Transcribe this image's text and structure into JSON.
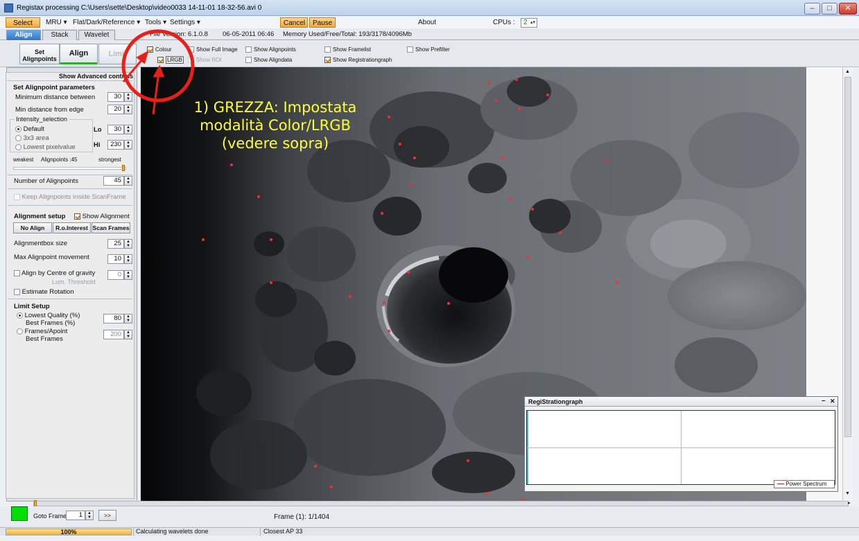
{
  "window": {
    "title": "Registax processing C:\\Users\\sette\\Desktop\\video0033 14-11-01 18-32-56.avi 0"
  },
  "menu": {
    "select": "Select",
    "mru": "MRU",
    "flat": "Flat/Dark/Reference",
    "tools": "Tools",
    "settings": "Settings",
    "cancel": "Cancel",
    "pause": "Pause",
    "about": "About",
    "cpus_label": "CPUs :",
    "cpus_value": "2"
  },
  "tabs": {
    "align": "Align",
    "stack": "Stack",
    "wavelet": "Wavelet"
  },
  "info": {
    "file_version": "File Version: 6.1.0.8",
    "date": "06-05-2011 06:46",
    "memory": "Memory Used/Free/Total: 193/3178/4096Mb"
  },
  "toolbar": {
    "set_alignpoints_1": "Set",
    "set_alignpoints_2": "Alignpoints",
    "align": "Align",
    "limit": "Limit"
  },
  "options": {
    "colour": "Colour",
    "lrgb": "LRGB",
    "show_full_image": "Show Full Image",
    "show_roi": "Show ROI",
    "show_alignpoints": "Show Alignpoints",
    "show_aligndata": "Show Aligndata",
    "show_framelist": "Show Framelist",
    "show_registrationgraph": "Show Registrationgraph",
    "show_prefilter": "Show Prefilter"
  },
  "panel": {
    "show_advanced": "Show Advanced controls",
    "set_ap_title": "Set Alignpoint parameters",
    "min_dist_between": "Minimum distance between",
    "min_dist_between_val": "30",
    "min_dist_edge": "Min distance from edge",
    "min_dist_edge_val": "20",
    "intensity_selection": "Intensity_selection",
    "default": "Default",
    "area3x3": "3x3 area",
    "lowest_pixel": "Lowest pixelvalue",
    "lo_label": "Lo",
    "lo_val": "30",
    "hi_label": "Hi",
    "hi_val": "230",
    "weakest": "weakest",
    "alignpoints_count": "Alignpoints :45",
    "strongest": "strongest",
    "num_alignpoints": "Number of Alignpoints",
    "num_alignpoints_val": "45",
    "keep_inside": "Keep Alignpoints inside ScanFrame",
    "alignment_setup": "Alignment setup",
    "show_alignment": "Show Alignment",
    "no_align": "No Align",
    "ro_interest": "R.o.Interest",
    "scan_frames": "Scan Frames",
    "alignbox_size": "Alignmentbox size",
    "alignbox_size_val": "25",
    "max_ap_move": "Max Alignpoint movement",
    "max_ap_move_val": "10",
    "align_cog": "Align by Centre of gravity",
    "align_cog_val": "0",
    "lum_threshold": "Lum. Threshold",
    "estimate_rotation": "Estimate Rotation",
    "limit_setup": "Limit Setup",
    "lowest_quality": "Lowest Quality (%)",
    "lowest_quality_val": "80",
    "best_frames_pct": "Best Frames (%)",
    "frames_apoint": "Frames/Apoint",
    "best_frames": "Best Frames",
    "best_frames_val": "200"
  },
  "annotation": {
    "line1": "1) GREZZA: Impostata",
    "line2": "modalità Color/LRGB",
    "line3": "(vedere sopra)"
  },
  "registration": {
    "title": "RegiStrationgraph",
    "legend": "Power Spectrum"
  },
  "bottom": {
    "goto_frame": "Goto Frame",
    "goto_val": "1",
    "next": ">>",
    "frame_info": "Frame (1): 1/1404"
  },
  "status": {
    "progress": "100%",
    "progress_fraction": 1.0,
    "message": "Calculating wavelets done",
    "closest_ap": "Closest AP 33"
  },
  "colors": {
    "accent_orange": "#f4a93a",
    "annotation_red": "#e8201a",
    "annotation_text": "#ffff2e",
    "alignpoint_red": "#ff2a2a"
  }
}
